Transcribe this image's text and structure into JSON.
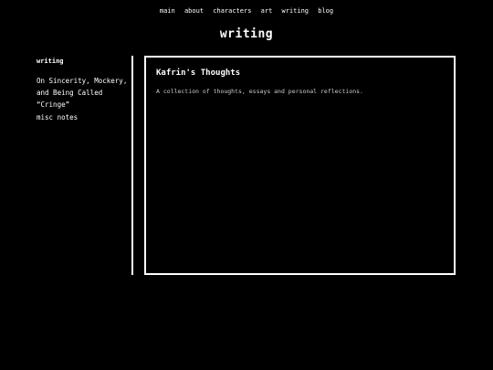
{
  "nav": {
    "items": [
      {
        "label": "main"
      },
      {
        "label": "about"
      },
      {
        "label": "characters"
      },
      {
        "label": "art"
      },
      {
        "label": "writing"
      },
      {
        "label": "blog"
      }
    ]
  },
  "page": {
    "title": "writing"
  },
  "sidebar": {
    "heading": "writing",
    "items": [
      {
        "label": "On Sincerity, Mockery, and Being Called “Cringe”"
      },
      {
        "label": "misc notes"
      }
    ]
  },
  "content": {
    "title": "Kafrin's Thoughts",
    "description": "A collection of thoughts, essays and personal reflections."
  }
}
